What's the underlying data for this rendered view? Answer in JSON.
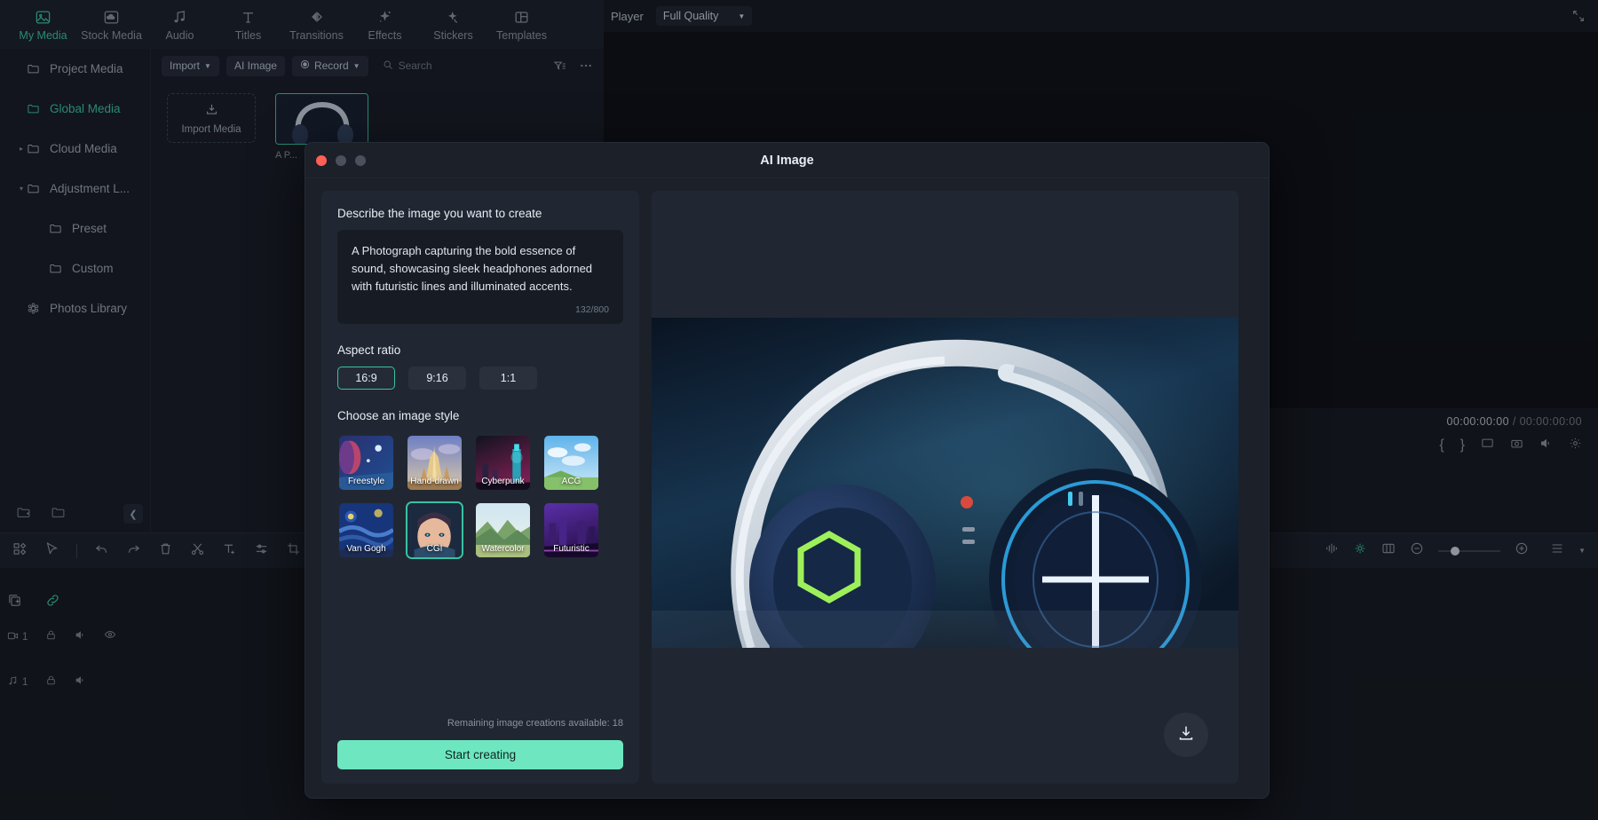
{
  "app": {
    "top_nav": [
      {
        "label": "My Media",
        "icon": "media-image-icon",
        "active": true
      },
      {
        "label": "Stock Media",
        "icon": "cloud-box-icon",
        "active": false
      },
      {
        "label": "Audio",
        "icon": "music-note-icon",
        "active": false
      },
      {
        "label": "Titles",
        "icon": "text-t-icon",
        "active": false
      },
      {
        "label": "Transitions",
        "icon": "transitions-arrow-icon",
        "active": false
      },
      {
        "label": "Effects",
        "icon": "sparkle-star-icon",
        "active": false
      },
      {
        "label": "Stickers",
        "icon": "sticker-sparkle-icon",
        "active": false
      },
      {
        "label": "Templates",
        "icon": "template-grid-icon",
        "active": false
      }
    ]
  },
  "sidebar": {
    "items": [
      {
        "label": "Project Media",
        "icon": "folder-icon",
        "active": false,
        "indent": false,
        "caret": ""
      },
      {
        "label": "Global Media",
        "icon": "folder-icon",
        "active": true,
        "indent": false,
        "caret": ""
      },
      {
        "label": "Cloud Media",
        "icon": "folder-icon",
        "active": false,
        "indent": false,
        "caret": "▸"
      },
      {
        "label": "Adjustment L...",
        "icon": "folder-icon",
        "active": false,
        "indent": false,
        "caret": "▾"
      },
      {
        "label": "Preset",
        "icon": "folder-icon",
        "active": false,
        "indent": true,
        "caret": ""
      },
      {
        "label": "Custom",
        "icon": "folder-icon",
        "active": false,
        "indent": true,
        "caret": ""
      },
      {
        "label": "Photos Library",
        "icon": "photos-library-icon",
        "active": false,
        "indent": false,
        "caret": ""
      }
    ],
    "collapse_icon": "chevron-left-icon"
  },
  "media_panel": {
    "toolbar": {
      "import_label": "Import",
      "ai_image_label": "AI Image",
      "record_label": "Record",
      "search_placeholder": "Search",
      "filter_icon": "filter-sort-icon",
      "more_icon": "more-dots-icon"
    },
    "import_card_label": "Import Media",
    "thumb_caption": "A P..."
  },
  "player": {
    "label": "Player",
    "quality": "Full Quality",
    "expand_icon": "expand-screen-icon",
    "current_time": "00:00:00:00",
    "separator": "/",
    "total_time": "00:00:00:00"
  },
  "timeline": {
    "video_track": {
      "num": "1",
      "icon": "video-track-icon"
    },
    "audio_track": {
      "num": "1",
      "icon": "audio-track-icon"
    }
  },
  "modal": {
    "title": "AI Image",
    "traffic_lights": [
      "#ff5f56",
      "#4a515c",
      "#4a515c"
    ],
    "describe_label": "Describe the image you want to create",
    "prompt_value": "A Photograph capturing the bold essence of sound, showcasing sleek headphones adorned with futuristic lines and illuminated accents.",
    "char_count": "132/800",
    "aspect_label": "Aspect ratio",
    "aspect_options": [
      {
        "label": "16:9",
        "selected": true
      },
      {
        "label": "9:16",
        "selected": false
      },
      {
        "label": "1:1",
        "selected": false
      }
    ],
    "style_label": "Choose an image style",
    "styles": [
      {
        "label": "Freestyle",
        "selected": false
      },
      {
        "label": "Hand-drawn",
        "selected": false
      },
      {
        "label": "Cyberpunk",
        "selected": false
      },
      {
        "label": "ACG",
        "selected": false
      },
      {
        "label": "Van Gogh",
        "selected": false
      },
      {
        "label": "CGI",
        "selected": true
      },
      {
        "label": "Watercolor",
        "selected": false
      },
      {
        "label": "Futuristic",
        "selected": false
      }
    ],
    "remaining_text": "Remaining image creations available: 18",
    "create_button": "Start creating",
    "download_icon": "download-icon"
  },
  "colors": {
    "accent": "#39c2a3",
    "button": "#6ee7c0",
    "bg": "#15191f",
    "panel": "#212732",
    "close_red": "#ff5f56"
  }
}
